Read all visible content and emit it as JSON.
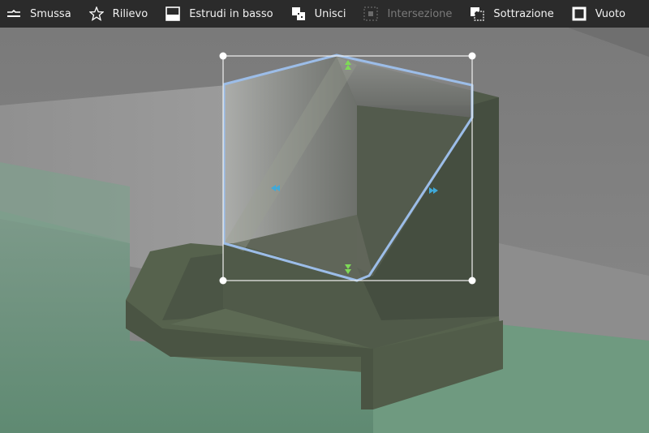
{
  "toolbar": {
    "items": [
      {
        "id": "smussa",
        "label": "Smussa",
        "icon": "chamfer-icon",
        "enabled": true
      },
      {
        "id": "rilievo",
        "label": "Rilievo",
        "icon": "star-icon",
        "enabled": true
      },
      {
        "id": "estrudi",
        "label": "Estrudi in basso",
        "icon": "extrude-down-icon",
        "enabled": true
      },
      {
        "id": "unisci",
        "label": "Unisci",
        "icon": "union-icon",
        "enabled": true
      },
      {
        "id": "intersezione",
        "label": "Intersezione",
        "icon": "intersect-icon",
        "enabled": false
      },
      {
        "id": "sottrazione",
        "label": "Sottrazione",
        "icon": "subtract-icon",
        "enabled": true
      },
      {
        "id": "vuoto",
        "label": "Vuoto",
        "icon": "hollow-icon",
        "enabled": true
      }
    ]
  },
  "colors": {
    "toolbar_bg": "#2b2b2b",
    "selection_outline": "#9cbde8",
    "handle_green": "#7ed957",
    "handle_blue": "#3fa9d9",
    "model_green": "#56624d"
  }
}
